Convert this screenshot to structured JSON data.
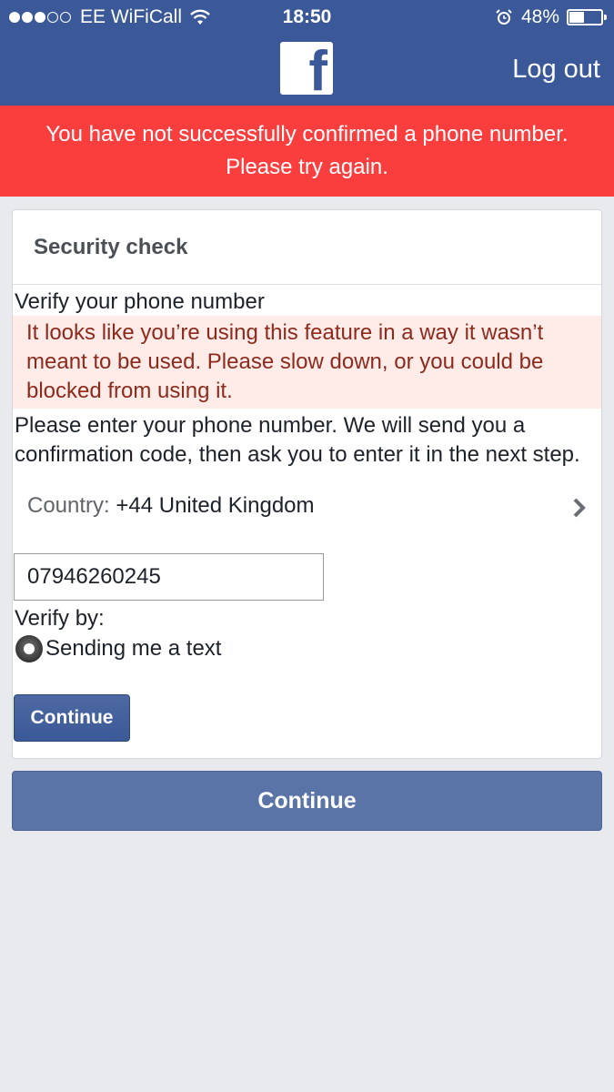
{
  "status_bar": {
    "carrier": "EE WiFiCall",
    "time": "18:50",
    "battery_text": "48%",
    "battery_level": 0.48,
    "signal_bars_filled": 3,
    "signal_bars_total": 5,
    "icons": [
      "wifi-icon",
      "alarm-icon",
      "battery-icon"
    ]
  },
  "header": {
    "logo": "facebook-logo",
    "logout_label": "Log out",
    "color": "#3b5998"
  },
  "error_banner": {
    "line1": "You have not successfully confirmed a phone number.",
    "line2": "Please try again.",
    "color": "#fa3e3e"
  },
  "card": {
    "title": "Security check",
    "heading": "Verify your phone number",
    "warning": "It looks like you’re using this feature in a way it wasn’t meant to be used. Please slow down, or you could be blocked from using it.",
    "instructions": "Please enter your phone number. We will send you a confirmation code, then ask you to enter it in the next step.",
    "country_label": "Country:",
    "country_value": "+44 United Kingdom",
    "phone_value": "07946260245",
    "verify_by_label": "Verify by:",
    "verify_option": "Sending me a text",
    "continue_label": "Continue"
  },
  "footer": {
    "continue_label": "Continue"
  }
}
